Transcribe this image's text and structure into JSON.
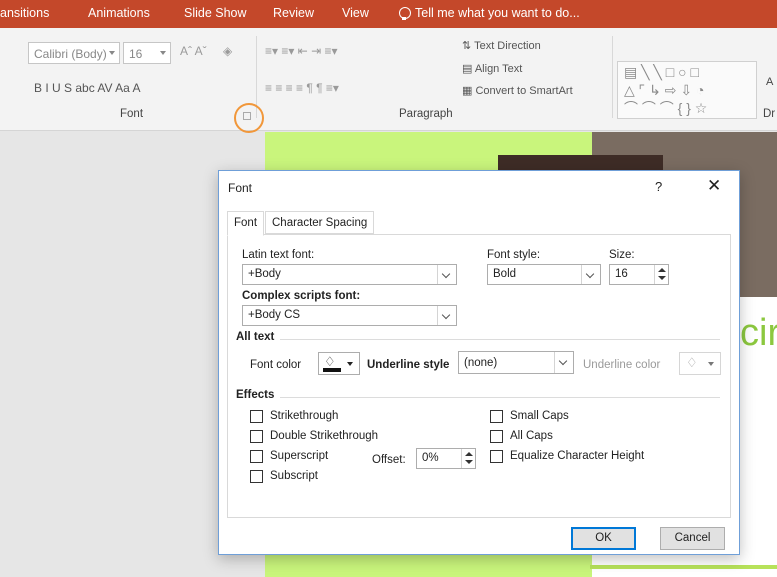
{
  "ribbon_tabs": [
    {
      "label": "ansitions"
    },
    {
      "label": "Animations"
    },
    {
      "label": "Slide Show"
    },
    {
      "label": "Review"
    },
    {
      "label": "View"
    }
  ],
  "tell_me": "Tell me what you want to do...",
  "ribbon": {
    "font_name": "Calibri (Body)",
    "font_size": "16",
    "font_group_label": "Font",
    "paragraph_group_label": "Paragraph",
    "text_direction": "Text Direction",
    "align_text": "Align Text",
    "convert_smartart": "Convert to SmartArt",
    "grow_shrink_glyphs": "Aˆ Aˇ",
    "format_glyphs": "B  I  U  S  abc  AV  Aa  A",
    "draw_cut_label": "Dr",
    "a_cut_label": "A"
  },
  "slide": {
    "title_fragment": "cir"
  },
  "dialog": {
    "title": "Font",
    "help": "?",
    "close": "✕",
    "tabs": [
      {
        "label": "Font",
        "active": true
      },
      {
        "label": "Character Spacing",
        "active": false
      }
    ],
    "latin_label": "Latin text font:",
    "latin_value": "+Body",
    "style_label": "Font style:",
    "style_value": "Bold",
    "size_label": "Size:",
    "size_value": "16",
    "complex_label": "Complex scripts font:",
    "complex_value": "+Body CS",
    "all_text_heading": "All text",
    "font_color_label": "Font color",
    "underline_style_label": "Underline style",
    "underline_style_value": "(none)",
    "underline_color_label": "Underline color",
    "effects_heading": "Effects",
    "effects_left": [
      {
        "label": "Strikethrough",
        "checked": false
      },
      {
        "label": "Double Strikethrough",
        "checked": false
      },
      {
        "label": "Superscript",
        "checked": false
      },
      {
        "label": "Subscript",
        "checked": false
      }
    ],
    "effects_right": [
      {
        "label": "Small Caps",
        "checked": false
      },
      {
        "label": "All Caps",
        "checked": false
      },
      {
        "label": "Equalize Character Height",
        "checked": false
      }
    ],
    "offset_label": "Offset:",
    "offset_value": "0%",
    "ok_label": "OK",
    "cancel_label": "Cancel"
  },
  "colors": {
    "accent_bar": "#c4482a",
    "slide_green": "#c9f57c",
    "focus_ring": "#f1973a",
    "default_button": "#0078d7"
  }
}
